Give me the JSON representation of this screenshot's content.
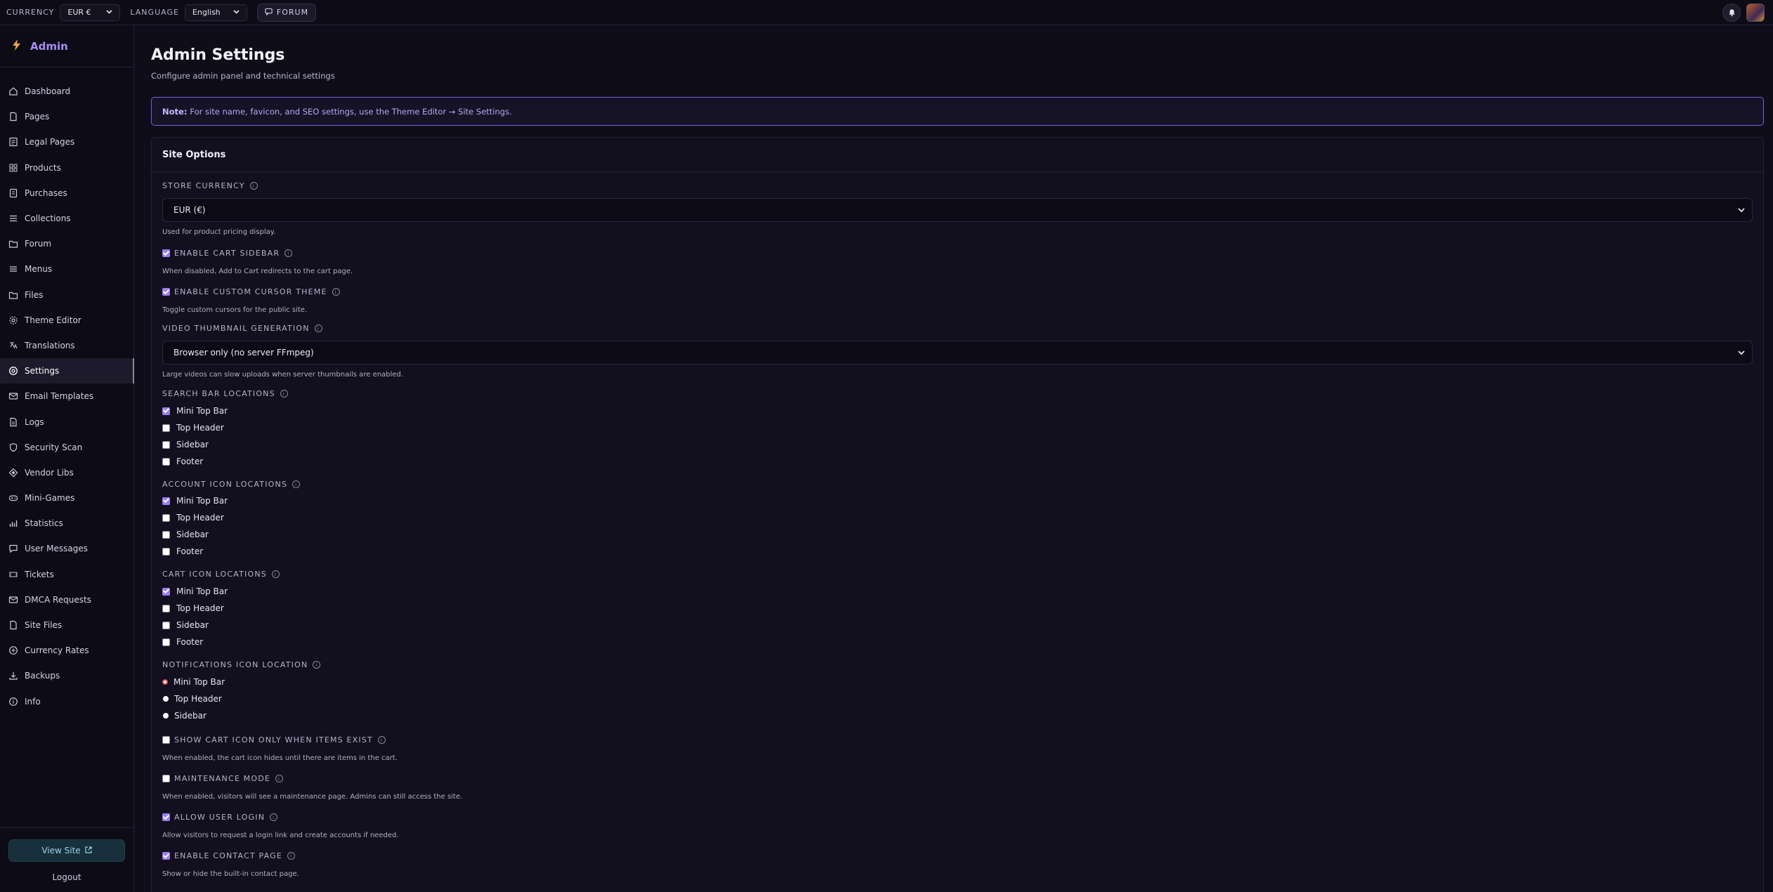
{
  "topbar": {
    "currency_label": "CURRENCY",
    "currency_value": "EUR €",
    "language_label": "LANGUAGE",
    "language_value": "English",
    "forum_label": "FORUM"
  },
  "sidebar": {
    "brand": "Admin",
    "items": [
      {
        "label": "Dashboard",
        "icon": "home-icon"
      },
      {
        "label": "Pages",
        "icon": "page-icon"
      },
      {
        "label": "Legal Pages",
        "icon": "legal-doc-icon"
      },
      {
        "label": "Products",
        "icon": "grid-icon"
      },
      {
        "label": "Purchases",
        "icon": "receipt-icon"
      },
      {
        "label": "Collections",
        "icon": "list-icon"
      },
      {
        "label": "Forum",
        "icon": "folder-icon"
      },
      {
        "label": "Menus",
        "icon": "menu-icon"
      },
      {
        "label": "Files",
        "icon": "folder-icon"
      },
      {
        "label": "Theme Editor",
        "icon": "gear-icon"
      },
      {
        "label": "Translations",
        "icon": "translate-icon"
      },
      {
        "label": "Settings",
        "icon": "settings-circle-icon"
      },
      {
        "label": "Email Templates",
        "icon": "mail-icon"
      },
      {
        "label": "Logs",
        "icon": "doc-icon"
      },
      {
        "label": "Security Scan",
        "icon": "shield-icon"
      },
      {
        "label": "Vendor Libs",
        "icon": "diamond-icon"
      },
      {
        "label": "Mini-Games",
        "icon": "gamepad-icon"
      },
      {
        "label": "Statistics",
        "icon": "stats-icon"
      },
      {
        "label": "User Messages",
        "icon": "chat-icon"
      },
      {
        "label": "Tickets",
        "icon": "ticket-icon"
      },
      {
        "label": "DMCA Requests",
        "icon": "mail-icon"
      },
      {
        "label": "Site Files",
        "icon": "file-icon"
      },
      {
        "label": "Currency Rates",
        "icon": "plus-circle-icon"
      },
      {
        "label": "Backups",
        "icon": "download-icon"
      },
      {
        "label": "Info",
        "icon": "info-icon"
      }
    ],
    "active_index": 11,
    "view_site": "View Site",
    "logout": "Logout"
  },
  "main": {
    "title": "Admin Settings",
    "subtitle": "Configure admin panel and technical settings",
    "note_bold": "Note:",
    "note_text": "For site name, favicon, and SEO settings, use the Theme Editor → Site Settings.",
    "card_title": "Site Options",
    "store_currency": {
      "label": "STORE CURRENCY",
      "value": "EUR (€)",
      "help": "Used for product pricing display."
    },
    "cart_sidebar": {
      "label": "ENABLE CART SIDEBAR",
      "checked": true,
      "help": "When disabled, Add to Cart redirects to the cart page."
    },
    "cursor_theme": {
      "label": "ENABLE CUSTOM CURSOR THEME",
      "checked": true,
      "help": "Toggle custom cursors for the public site."
    },
    "video_thumb": {
      "label": "VIDEO THUMBNAIL GENERATION",
      "value": "Browser only (no server FFmpeg)",
      "help": "Large videos can slow uploads when server thumbnails are enabled."
    },
    "search_bar": {
      "label": "SEARCH BAR LOCATIONS",
      "options": [
        {
          "label": "Mini Top Bar",
          "checked": true
        },
        {
          "label": "Top Header",
          "checked": false
        },
        {
          "label": "Sidebar",
          "checked": false
        },
        {
          "label": "Footer",
          "checked": false
        }
      ]
    },
    "account_icon": {
      "label": "ACCOUNT ICON LOCATIONS",
      "options": [
        {
          "label": "Mini Top Bar",
          "checked": true
        },
        {
          "label": "Top Header",
          "checked": false
        },
        {
          "label": "Sidebar",
          "checked": false
        },
        {
          "label": "Footer",
          "checked": false
        }
      ]
    },
    "cart_icon": {
      "label": "CART ICON LOCATIONS",
      "options": [
        {
          "label": "Mini Top Bar",
          "checked": true
        },
        {
          "label": "Top Header",
          "checked": false
        },
        {
          "label": "Sidebar",
          "checked": false
        },
        {
          "label": "Footer",
          "checked": false
        }
      ]
    },
    "notif_icon": {
      "label": "NOTIFICATIONS ICON LOCATION",
      "options": [
        {
          "label": "Mini Top Bar",
          "selected": true
        },
        {
          "label": "Top Header",
          "selected": false
        },
        {
          "label": "Sidebar",
          "selected": false
        }
      ]
    },
    "cart_only_items": {
      "label": "SHOW CART ICON ONLY WHEN ITEMS EXIST",
      "checked": false,
      "help": "When enabled, the cart icon hides until there are items in the cart."
    },
    "maintenance": {
      "label": "MAINTENANCE MODE",
      "checked": false,
      "help": "When enabled, visitors will see a maintenance page. Admins can still access the site."
    },
    "user_login": {
      "label": "ALLOW USER LOGIN",
      "checked": true,
      "help": "Allow visitors to request a login link and create accounts if needed."
    },
    "contact_page": {
      "label": "ENABLE CONTACT PAGE",
      "checked": true,
      "help": "Show or hide the built-in contact page."
    }
  },
  "colors": {
    "accent": "#9b7ef0",
    "background": "#0f0d1a",
    "radio_selected": "#e14b4b"
  }
}
